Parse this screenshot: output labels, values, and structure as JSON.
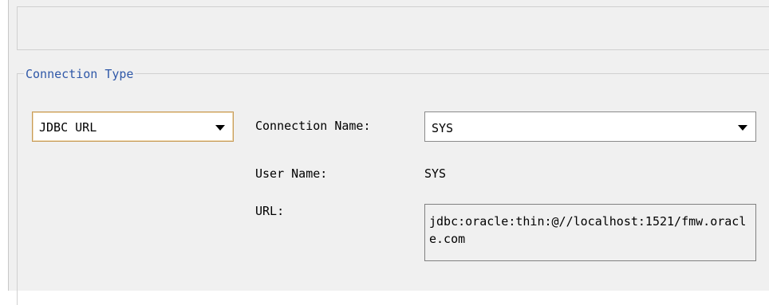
{
  "group": {
    "title": "Connection Type"
  },
  "connection_type": {
    "selected": "JDBC URL"
  },
  "connection": {
    "name_label": "Connection Name:",
    "name_value": "SYS",
    "user_label": "User Name:",
    "user_value": "SYS",
    "url_label": "URL:",
    "url_value": "jdbc:oracle:thin:@//localhost:1521/fmw.oracle.com"
  },
  "colors": {
    "panel_bg": "#f0f0f0",
    "group_title": "#2f58a8",
    "focus_border": "#c79b57"
  },
  "icons": {
    "dropdown": "chevron-down-icon"
  }
}
